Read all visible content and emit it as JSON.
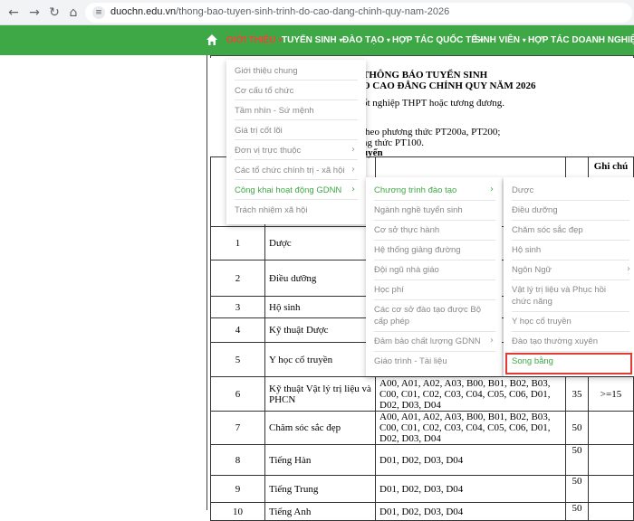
{
  "browser": {
    "url_host": "duochn.edu.vn",
    "url_path": "/thong-bao-tuyen-sinh-trinh-do-cao-dang-chinh-quy-nam-2026"
  },
  "nav": {
    "items": [
      {
        "label": "GIỚI THIỆU",
        "active": true
      },
      {
        "label": "TUYỂN SINH"
      },
      {
        "label": "ĐÀO TẠO"
      },
      {
        "label": "HỢP TÁC QUỐC TẾ"
      },
      {
        "label": "SINH VIÊN"
      },
      {
        "label": "HỢP TÁC DOANH NGHIỆP"
      }
    ]
  },
  "document": {
    "heading1": "THÔNG BÁO TUYỂN SINH",
    "heading2": "O CAO ĐẲNG CHÍNH QUY NĂM 2026",
    "line1": "ốt nghiệp THPT hoặc tương đương.",
    "line2": "theo phương thức PT200a, PT200;",
    "line3": "ng thức PT100.",
    "line4": "uyển",
    "note_header": "Ghi chú"
  },
  "table": {
    "rows": [
      {
        "stt": "1",
        "name": "Dược",
        "codes": "",
        "quota": "",
        "note": ""
      },
      {
        "stt": "2",
        "name": "Điều dưỡng",
        "codes": "",
        "quota": "",
        "note": ""
      },
      {
        "stt": "3",
        "name": "Hộ sinh",
        "codes": "",
        "quota": "",
        "note": ""
      },
      {
        "stt": "4",
        "name": "Kỹ thuật Dược",
        "codes": "",
        "quota": "",
        "note": ""
      },
      {
        "stt": "5",
        "name": "Y học cổ truyền",
        "codes": "",
        "quota": "",
        "note": ""
      },
      {
        "stt": "6",
        "name": "Kỹ thuật Vật lý trị liệu và PHCN",
        "codes": "A00, A01, A02, A03, B00, B01, B02, B03, C00, C01, C02, C03, C04, C05, C06, D01, D02, D03, D04",
        "quota": "35",
        "note": ">=15"
      },
      {
        "stt": "7",
        "name": "Chăm sóc sắc đẹp",
        "codes": "A00, A01, A02, A03, B00, B01, B02, B03, C00, C01, C02, C03, C04, C05, C06, D01, D02, D03, D04",
        "quota": "50",
        "note": ""
      },
      {
        "stt": "8",
        "name": "Tiếng Hàn",
        "codes": "D01, D02, D03, D04",
        "quota": "50",
        "note": ""
      },
      {
        "stt": "9",
        "name": "Tiếng Trung",
        "codes": "D01, D02, D03, D04",
        "quota": "50",
        "note": ""
      },
      {
        "stt": "10",
        "name": "Tiếng Anh",
        "codes": "D01, D02, D03, D04",
        "quota": "50",
        "note": ""
      }
    ]
  },
  "menu1": {
    "items": [
      {
        "label": "Giới thiệu chung"
      },
      {
        "label": "Cơ cấu tổ chức"
      },
      {
        "label": "Tầm nhìn - Sứ mệnh"
      },
      {
        "label": "Giá trị cốt lõi"
      },
      {
        "label": "Đơn vị trực thuộc",
        "sub": true
      },
      {
        "label": "Các tổ chức chính trị - xã hội",
        "sub": true
      },
      {
        "label": "Công khai hoạt động GDNN",
        "sub": true,
        "hl": true
      },
      {
        "label": "Trách nhiệm xã hội"
      }
    ]
  },
  "menu2": {
    "items": [
      {
        "label": "Chương trình đào tạo",
        "sub": true,
        "hl": true
      },
      {
        "label": "Ngành nghề tuyển sinh"
      },
      {
        "label": "Cơ sở thực hành"
      },
      {
        "label": "Hệ thống giảng đường"
      },
      {
        "label": "Đội ngũ nhà giáo"
      },
      {
        "label": "Học phí"
      },
      {
        "label": "Các cơ sở đào tạo được Bộ",
        "label2": "cấp phép"
      },
      {
        "label": "Đảm bảo chất lượng GDNN",
        "sub": true
      },
      {
        "label": "Giáo trình - Tài liệu"
      }
    ]
  },
  "menu3": {
    "items": [
      {
        "label": "Dược"
      },
      {
        "label": "Điều dưỡng"
      },
      {
        "label": "Chăm sóc sắc đẹp"
      },
      {
        "label": "Hộ sinh"
      },
      {
        "label": "Ngôn Ngữ",
        "sub": true
      },
      {
        "label": "Vật lý trị liệu và Phục hồi",
        "label2": "chức năng"
      },
      {
        "label": "Y học cổ truyền"
      },
      {
        "label": "Đào tạo thường xuyên"
      },
      {
        "label": "Song bằng",
        "hl": true
      }
    ]
  }
}
